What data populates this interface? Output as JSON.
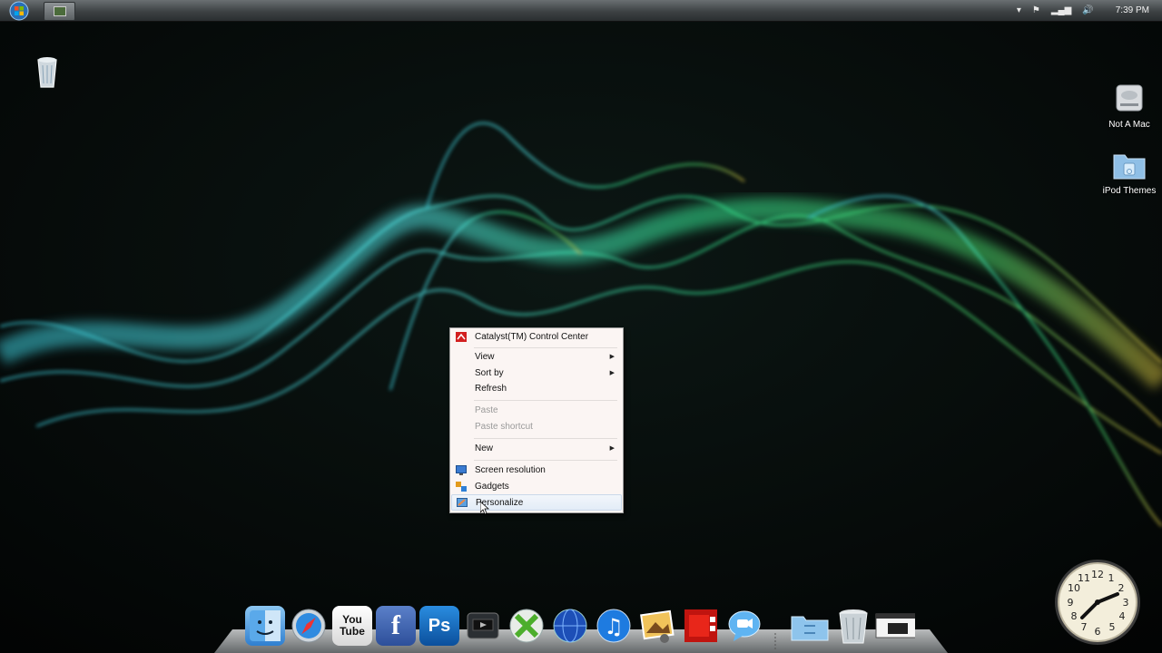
{
  "taskbar": {
    "start_button_label": "",
    "clock": "7:39 PM",
    "tray_icons": [
      "chevron-up-icon",
      "flag-icon",
      "network-icon",
      "volume-icon"
    ]
  },
  "desktop": {
    "icons": [
      {
        "name": "recycle-bin-icon",
        "label": ""
      },
      {
        "name": "hard-drive-icon",
        "label": "Not A Mac"
      },
      {
        "name": "folder-icon",
        "label": "iPod Themes"
      }
    ]
  },
  "context_menu": {
    "items": [
      {
        "label": "Catalyst(TM) Control Center",
        "icon": "catalyst-icon",
        "enabled": true,
        "submenu": false
      },
      {
        "label": "View",
        "enabled": true,
        "submenu": true
      },
      {
        "label": "Sort by",
        "enabled": true,
        "submenu": true
      },
      {
        "label": "Refresh",
        "enabled": true,
        "submenu": false
      },
      {
        "label": "Paste",
        "enabled": false,
        "submenu": false
      },
      {
        "label": "Paste shortcut",
        "enabled": false,
        "submenu": false
      },
      {
        "label": "New",
        "enabled": true,
        "submenu": true
      },
      {
        "label": "Screen resolution",
        "icon": "monitor-icon",
        "enabled": true,
        "submenu": false
      },
      {
        "label": "Gadgets",
        "icon": "gadgets-icon",
        "enabled": true,
        "submenu": false
      },
      {
        "label": "Personalize",
        "icon": "personalize-icon",
        "enabled": true,
        "submenu": false,
        "highlighted": true
      }
    ]
  },
  "dock": {
    "apps": [
      {
        "name": "finder",
        "glyph": ""
      },
      {
        "name": "safari",
        "glyph": ""
      },
      {
        "name": "youtube",
        "glyph": "You Tube"
      },
      {
        "name": "facebook",
        "glyph": "f"
      },
      {
        "name": "photoshop",
        "glyph": "Ps"
      },
      {
        "name": "front-row",
        "glyph": ""
      },
      {
        "name": "xbox",
        "glyph": ""
      },
      {
        "name": "browser-globe",
        "glyph": ""
      },
      {
        "name": "itunes",
        "glyph": "♫"
      },
      {
        "name": "iphoto",
        "glyph": ""
      },
      {
        "name": "photo-booth",
        "glyph": ""
      },
      {
        "name": "ichat",
        "glyph": ""
      },
      {
        "name": "downloads-folder",
        "glyph": ""
      },
      {
        "name": "trash",
        "glyph": ""
      },
      {
        "name": "show-desktop",
        "glyph": ""
      }
    ]
  },
  "gadget_clock": {
    "numerals": [
      "12",
      "1",
      "2",
      "3",
      "4",
      "5",
      "6",
      "7",
      "8",
      "9",
      "10",
      "11"
    ]
  },
  "colors": {
    "taskbar": "#3d4244",
    "menu_bg": "#fbf5f3",
    "smoke_cyan": "#4fe0e6",
    "smoke_green": "#3fe58e"
  }
}
